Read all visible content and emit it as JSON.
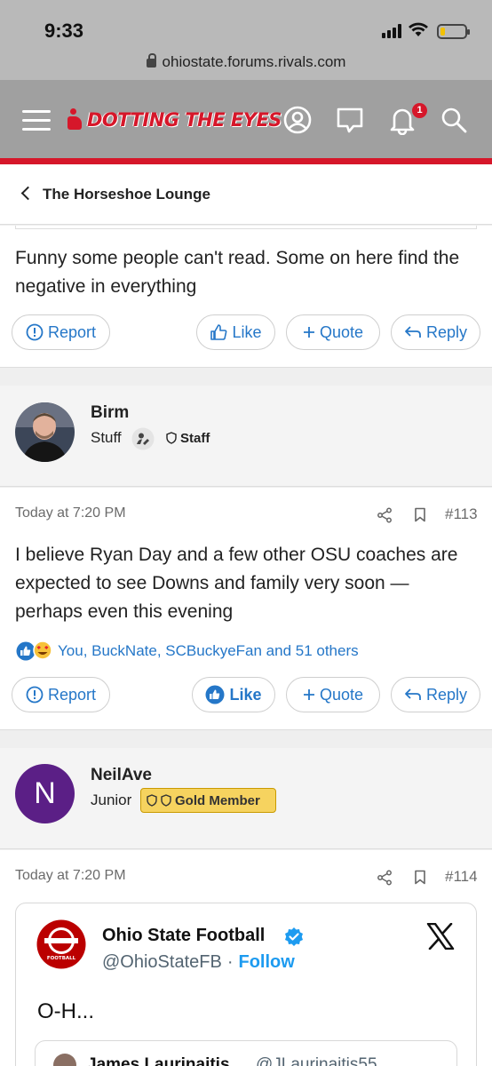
{
  "status_bar": {
    "time": "9:33",
    "battery_level": 0.2
  },
  "browser": {
    "url": "ohiostate.forums.rivals.com"
  },
  "header": {
    "site_logo": "DOTTING THE EYES",
    "notification_count": "1",
    "icons": [
      "menu-icon",
      "account-icon",
      "chat-icon",
      "bell-icon",
      "search-icon"
    ],
    "accent_color": "#d6172a"
  },
  "breadcrumb": {
    "label": "The Horseshoe Lounge"
  },
  "post_prev": {
    "text": "Funny some people can't read. Some on here find the negative in everything",
    "report_label": "Report",
    "like_label": "Like",
    "quote_label": "Quote",
    "reply_label": "Reply"
  },
  "post_113": {
    "author": "Birm",
    "user_title": "Stuff",
    "staff_label": "Staff",
    "timestamp": "Today at 7:20 PM",
    "post_number": "#113",
    "text": "I believe Ryan Day and a few other OSU coaches are expected to see Downs and family very soon — perhaps even this evening",
    "reactions": "You, BuckNate, SCBuckyeFan and 51 others",
    "report_label": "Report",
    "like_label": "Like",
    "quote_label": "Quote",
    "reply_label": "Reply"
  },
  "post_114": {
    "author": "NeilAve",
    "avatar_letter": "N",
    "user_title": "Junior",
    "member_badge": "Gold Member",
    "timestamp": "Today at 7:20 PM",
    "post_number": "#114",
    "embed": {
      "account_name": "Ohio State Football",
      "handle": "@OhioStateFB",
      "separator": "·",
      "follow_label": "Follow",
      "tweet_text": "O-H...",
      "logo_text": "FOOTBALL",
      "quoted_author": "James Laurinaitis",
      "quoted_handle": "@JLaurinaitis55"
    }
  }
}
